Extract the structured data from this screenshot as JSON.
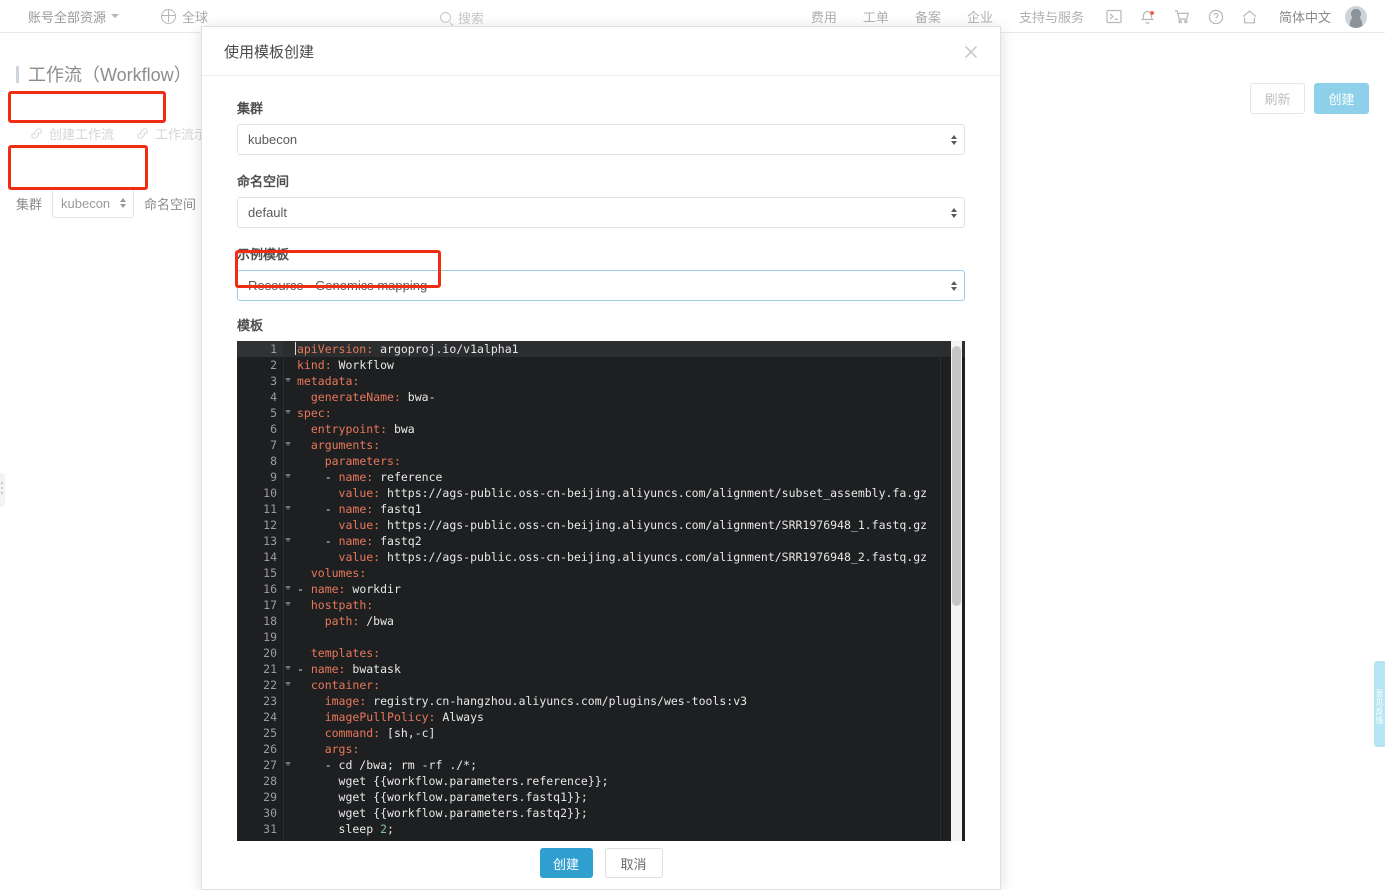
{
  "topnav": {
    "account_label": "账号全部资源",
    "region_label": "全球",
    "search_placeholder": "搜索",
    "menu": [
      {
        "label": "费用"
      },
      {
        "label": "工单"
      },
      {
        "label": "备案"
      },
      {
        "label": "企业"
      },
      {
        "label": "支持与服务"
      }
    ],
    "icons": [
      "terminal-icon",
      "bell-icon",
      "cart-icon",
      "help-icon",
      "home-icon"
    ],
    "language": "简体中文"
  },
  "page": {
    "title": "工作流（Workflow）",
    "tools": [
      {
        "label": "创建工作流",
        "icon": "link-icon"
      },
      {
        "label": "工作流示例模",
        "icon": "link-icon"
      }
    ],
    "filters": {
      "cluster_label": "集群",
      "cluster_value": "kubecon",
      "namespace_label": "命名空间"
    },
    "buttons": {
      "refresh": "刷新",
      "create": "创建"
    },
    "right_flag": "意见反馈"
  },
  "modal": {
    "title": "使用模板创建",
    "close_icon": "close-icon",
    "fields": [
      {
        "label": "集群",
        "value": "kubecon",
        "name": "cluster"
      },
      {
        "label": "命名空间",
        "value": "default",
        "name": "namespace"
      },
      {
        "label": "示例模板",
        "value": "Resource - Genomics mapping",
        "name": "example-template"
      }
    ],
    "template_label": "模板",
    "buttons": {
      "create": "创建",
      "cancel": "取消"
    }
  },
  "code": {
    "language": "yaml",
    "active_line": 1,
    "lines": [
      {
        "n": 1,
        "fold": false,
        "indent": 0,
        "key": "apiVersion",
        "value": "argoproj.io/v1alpha1"
      },
      {
        "n": 2,
        "fold": false,
        "indent": 0,
        "key": "kind",
        "value": "Workflow"
      },
      {
        "n": 3,
        "fold": true,
        "indent": 0,
        "key": "metadata",
        "value": ""
      },
      {
        "n": 4,
        "fold": false,
        "indent": 2,
        "key": "generateName",
        "value": "bwa-"
      },
      {
        "n": 5,
        "fold": true,
        "indent": 0,
        "key": "spec",
        "value": ""
      },
      {
        "n": 6,
        "fold": false,
        "indent": 2,
        "key": "entrypoint",
        "value": "bwa"
      },
      {
        "n": 7,
        "fold": true,
        "indent": 2,
        "key": "arguments",
        "value": ""
      },
      {
        "n": 8,
        "fold": false,
        "indent": 4,
        "key": "parameters",
        "value": ""
      },
      {
        "n": 9,
        "fold": true,
        "indent": 4,
        "dashkey": "name",
        "value": "reference"
      },
      {
        "n": 10,
        "fold": false,
        "indent": 6,
        "key": "value",
        "value": "https://ags-public.oss-cn-beijing.aliyuncs.com/alignment/subset_assembly.fa.gz"
      },
      {
        "n": 11,
        "fold": true,
        "indent": 4,
        "dashkey": "name",
        "value": "fastq1"
      },
      {
        "n": 12,
        "fold": false,
        "indent": 6,
        "key": "value",
        "value": "https://ags-public.oss-cn-beijing.aliyuncs.com/alignment/SRR1976948_1.fastq.gz"
      },
      {
        "n": 13,
        "fold": true,
        "indent": 4,
        "dashkey": "name",
        "value": "fastq2"
      },
      {
        "n": 14,
        "fold": false,
        "indent": 6,
        "key": "value",
        "value": "https://ags-public.oss-cn-beijing.aliyuncs.com/alignment/SRR1976948_2.fastq.gz"
      },
      {
        "n": 15,
        "fold": false,
        "indent": 2,
        "key": "volumes",
        "value": ""
      },
      {
        "n": 16,
        "fold": true,
        "indent": 0,
        "dashkey": "name",
        "value": "workdir"
      },
      {
        "n": 17,
        "fold": true,
        "indent": 2,
        "key": "hostpath",
        "value": ""
      },
      {
        "n": 18,
        "fold": false,
        "indent": 4,
        "key": "path",
        "value": "/bwa"
      },
      {
        "n": 19,
        "fold": false,
        "indent": 0,
        "raw": ""
      },
      {
        "n": 20,
        "fold": false,
        "indent": 2,
        "key": "templates",
        "value": ""
      },
      {
        "n": 21,
        "fold": true,
        "indent": 0,
        "dashkey": "name",
        "value": "bwatask"
      },
      {
        "n": 22,
        "fold": true,
        "indent": 2,
        "key": "container",
        "value": ""
      },
      {
        "n": 23,
        "fold": false,
        "indent": 4,
        "key": "image",
        "value": "registry.cn-hangzhou.aliyuncs.com/plugins/wes-tools:v3"
      },
      {
        "n": 24,
        "fold": false,
        "indent": 4,
        "key": "imagePullPolicy",
        "value": "Always"
      },
      {
        "n": 25,
        "fold": false,
        "indent": 4,
        "key": "command",
        "value": "[sh,-c]"
      },
      {
        "n": 26,
        "fold": false,
        "indent": 4,
        "key": "args",
        "value": ""
      },
      {
        "n": 27,
        "fold": true,
        "indent": 4,
        "raw": "- cd /bwa; rm -rf ./*;"
      },
      {
        "n": 28,
        "fold": false,
        "indent": 6,
        "raw": "wget {{workflow.parameters.reference}};"
      },
      {
        "n": 29,
        "fold": false,
        "indent": 6,
        "raw": "wget {{workflow.parameters.fastq1}};"
      },
      {
        "n": 30,
        "fold": false,
        "indent": 6,
        "raw": "wget {{workflow.parameters.fastq2}};"
      },
      {
        "n": 31,
        "fold": false,
        "indent": 6,
        "raw": "sleep ",
        "numtail": "2",
        "tail": ";"
      }
    ]
  },
  "colors": {
    "editor_bg": "#1d1f21",
    "key": "#e8785a",
    "value": "#e8e8e8",
    "number": "#7ec699",
    "accent": "#2f9fd0",
    "highlight": "#f02d14"
  }
}
